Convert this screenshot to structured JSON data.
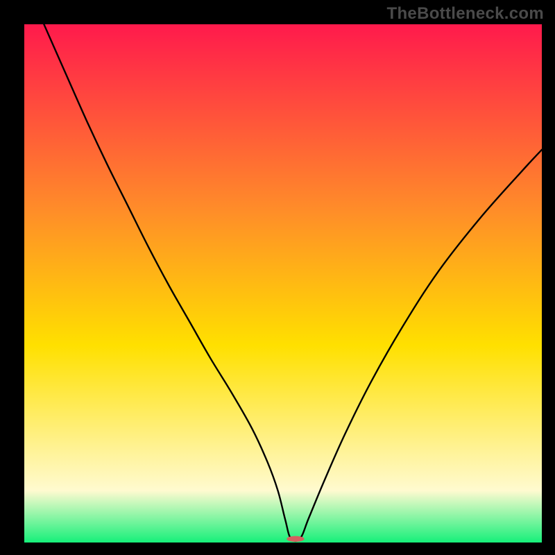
{
  "watermark": "TheBottleneck.com",
  "colors": {
    "gradient_top": "#ff1a4c",
    "gradient_mid_upper": "#ff8a2a",
    "gradient_mid": "#ffe000",
    "gradient_pale": "#fffad0",
    "gradient_bottom": "#16f07a",
    "curve": "#000000",
    "background": "#000000",
    "marker": "#d46060"
  },
  "frame": {
    "outer_w": 800,
    "outer_h": 800,
    "margin_left": 35,
    "margin_right": 19,
    "margin_top": 35,
    "margin_bottom": 18
  },
  "chart_data": {
    "type": "line",
    "title": "",
    "xlabel": "",
    "ylabel": "",
    "xlim": [
      0,
      100
    ],
    "ylim": [
      0,
      100
    ],
    "notes": "V-shaped bottleneck curve with sharp minimum; background is vertical rainbow gradient (red→orange→yellow→pale→green). Marker pill at minimum.",
    "series": [
      {
        "name": "bottleneck-curve",
        "x": [
          3.8,
          8,
          12,
          16,
          20,
          24,
          28,
          32,
          36,
          40,
          44,
          47,
          49,
          50.4,
          51.5,
          53.3,
          55,
          58,
          62,
          67,
          73,
          80,
          88,
          96,
          100
        ],
        "values": [
          100,
          90.5,
          81.5,
          73,
          65,
          57,
          49.5,
          42.5,
          35.5,
          29,
          22,
          15.5,
          10,
          4.5,
          0.8,
          0.8,
          4.8,
          12,
          21,
          31,
          41.5,
          52.3,
          62.5,
          71.5,
          75.8
        ]
      }
    ],
    "marker": {
      "x": 52.4,
      "y": 0.7,
      "rx": 1.7,
      "ry": 0.55
    }
  }
}
